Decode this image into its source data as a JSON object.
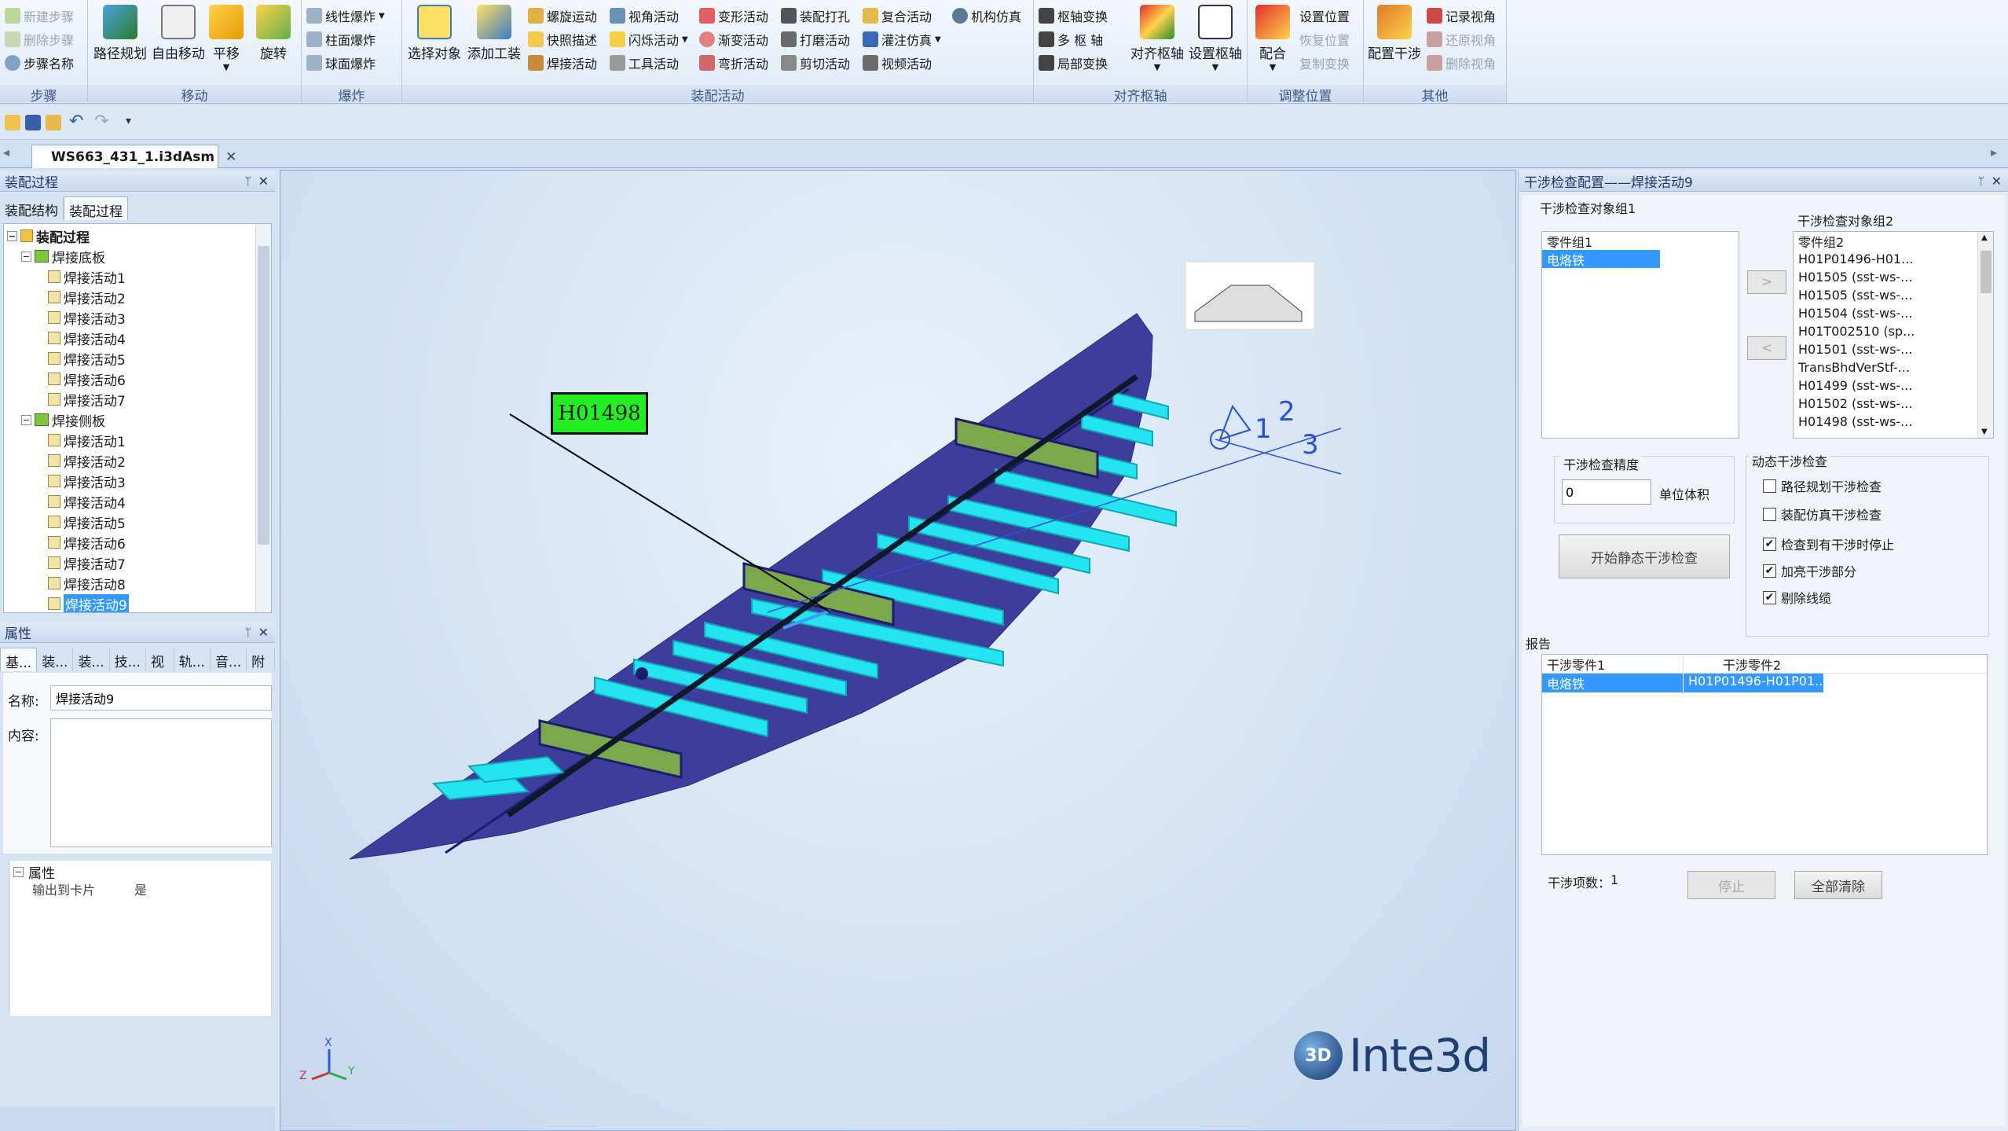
{
  "ribbon": {
    "groups": {
      "steps": "步骤",
      "move": "移动",
      "explode": "爆炸",
      "assembly": "装配活动",
      "axis": "对齐枢轴",
      "adjust": "调整位置",
      "other": "其他"
    },
    "steps": {
      "new": "新建步骤",
      "delete": "删除步骤",
      "name": "步骤名称"
    },
    "move": {
      "path": "路径规划",
      "free": "自由移动",
      "pan": "平移",
      "rotate": "旋转"
    },
    "explode": {
      "linear": "线性爆炸",
      "cylinder": "柱面爆炸",
      "sphere": "球面爆炸"
    },
    "assembly": {
      "select": "选择对象",
      "add_tool": "添加工装",
      "screw": "螺旋运动",
      "view_angle": "视角活动",
      "quick_desc": "快照描述",
      "flash": "闪烁活动",
      "weld": "焊接活动",
      "tool": "工具活动",
      "deform": "变形活动",
      "gradient": "渐变活动",
      "bend": "弯折活动",
      "drill": "装配打孔",
      "grind": "打磨活动",
      "cut": "剪切活动",
      "composite": "复合活动",
      "pour": "灌注仿真",
      "video": "视频活动",
      "mech": "机构仿真"
    },
    "axis": {
      "pivot_switch": "枢轴变换",
      "multi_pivot": "多 枢 轴",
      "local": "局部变换",
      "align": "对齐枢轴",
      "set": "设置枢轴"
    },
    "adjust": {
      "fit": "配合",
      "set_pos": "设置位置",
      "restore_pos": "恢复位置",
      "copy_transform": "复制变换"
    },
    "other": {
      "config": "配置干涉",
      "record_view": "记录视角",
      "restore_view": "还原视角",
      "delete_view": "删除视角"
    }
  },
  "doc_tab": "WS663_431_1.i3dAsm",
  "left": {
    "panel_title": "装配过程",
    "tabs": [
      "装配结构",
      "装配过程"
    ],
    "tree": {
      "root": "装配过程",
      "group1": "焊接底板",
      "group1_items": [
        "焊接活动1",
        "焊接活动2",
        "焊接活动3",
        "焊接活动4",
        "焊接活动5",
        "焊接活动6",
        "焊接活动7"
      ],
      "group2": "焊接侧板",
      "group2_items": [
        "焊接活动1",
        "焊接活动2",
        "焊接活动3",
        "焊接活动4",
        "焊接活动5",
        "焊接活动6",
        "焊接活动7",
        "焊接活动8",
        "焊接活动9"
      ]
    },
    "props_title": "属性",
    "props_tabs": [
      "基...",
      "装...",
      "装...",
      "技...",
      "视图",
      "轨...",
      "音...",
      "附件"
    ],
    "name_label": "名称:",
    "name_value": "焊接活动9",
    "content_label": "内容:",
    "attr_section": "属性",
    "attr_key": "输出到卡片",
    "attr_value": "是"
  },
  "viewport": {
    "callout": "H01498",
    "logo": "Inte3d",
    "axis_labels": [
      "1",
      "2",
      "3"
    ],
    "triad": [
      "X",
      "Y",
      "Z"
    ]
  },
  "right": {
    "panel_title": "干涉检查配置——焊接活动9",
    "group1_title": "干涉检查对象组1",
    "group1_items": [
      "零件组1",
      "电烙铁"
    ],
    "group2_title": "干涉检查对象组2",
    "group2_items": [
      "零件组2",
      "H01P01496-H01...",
      "H01505 (sst-ws-...",
      "H01505 (sst-ws-...",
      "H01504 (sst-ws-...",
      "H01T002510 (sp...",
      "H01501 (sst-ws-...",
      "TransBhdVerStf-...",
      "H01499 (sst-ws-...",
      "H01502 (sst-ws-...",
      "H01498 (sst-ws-..."
    ],
    "move_right": ">",
    "move_left": "<",
    "precision_title": "干涉检查精度",
    "precision_value": "0",
    "unit": "单位体积",
    "start_btn": "开始静态干涉检查",
    "dynamic_title": "动态干涉检查",
    "checks": [
      {
        "label": "路径规划干涉检查",
        "checked": false
      },
      {
        "label": "装配仿真干涉检查",
        "checked": false
      },
      {
        "label": "检查到有干涉时停止",
        "checked": true
      },
      {
        "label": "加亮干涉部分",
        "checked": true
      },
      {
        "label": "剔除线缆",
        "checked": true
      }
    ],
    "report_title": "报告",
    "report_cols": [
      "干涉零件1",
      "干涉零件2"
    ],
    "report_row": [
      "电烙铁",
      "H01P01496-H01P01..."
    ],
    "count_label": "干涉项数：",
    "count_value": "1",
    "stop_btn": "停止",
    "clear_btn": "全部清除"
  }
}
